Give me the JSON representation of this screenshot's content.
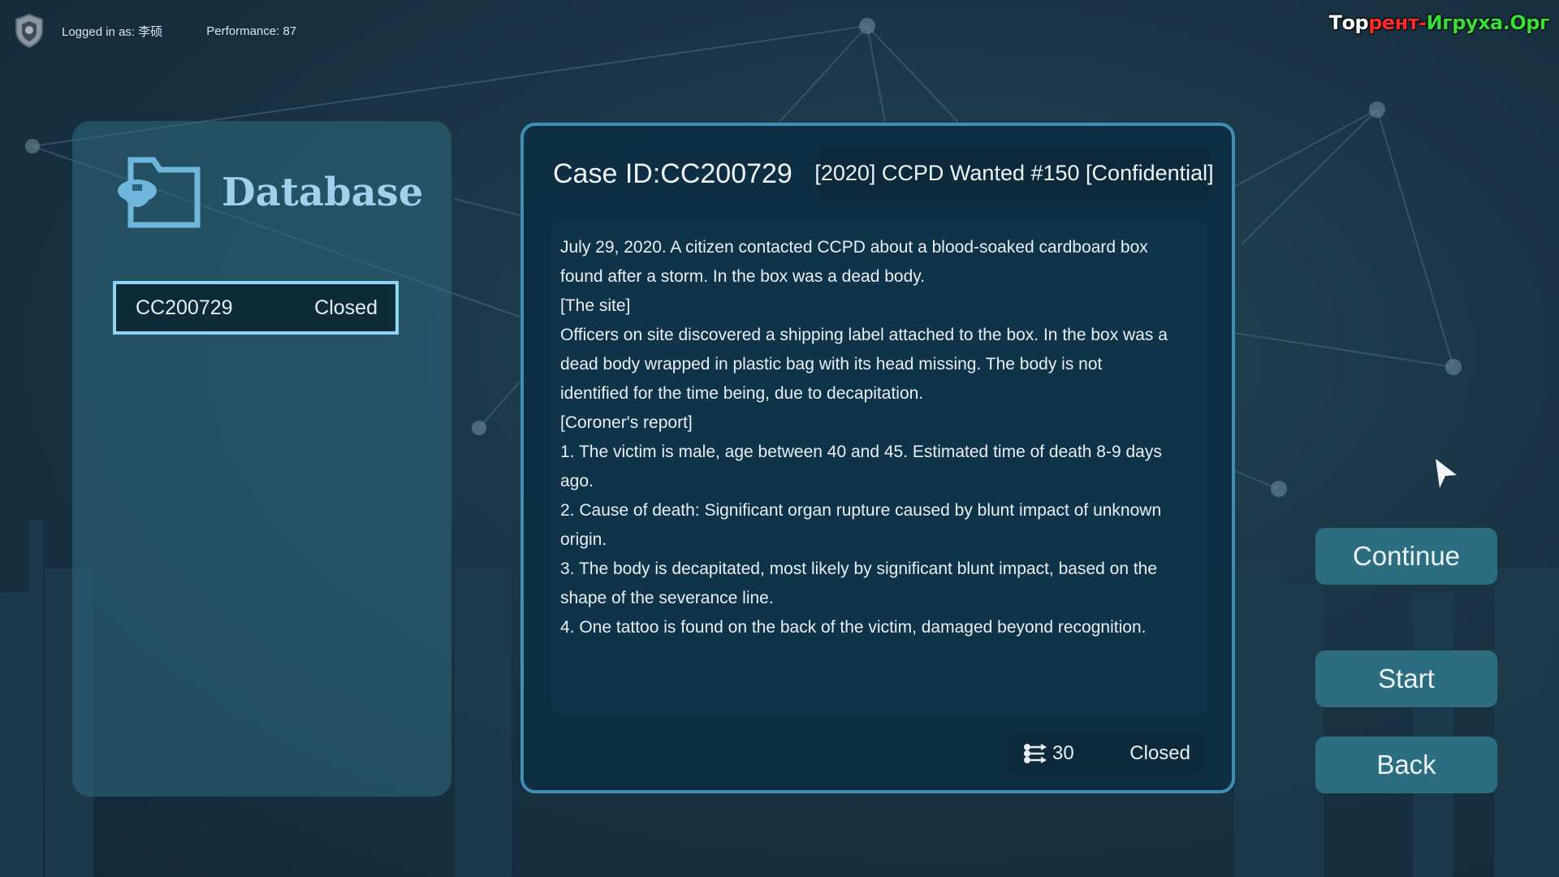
{
  "topbar": {
    "logged_in": "Logged in as: 李硕",
    "performance": "Performance: 87"
  },
  "watermark": {
    "part1": "Тор",
    "part2": "рент-",
    "part3": "Игруха",
    "part4": ".Орг"
  },
  "sidebar": {
    "title": "Database",
    "cases": [
      {
        "id": "CC200729",
        "status": "Closed"
      }
    ]
  },
  "case": {
    "id_label": "Case ID:CC200729",
    "title": "[2020] CCPD Wanted #150 [Confidential]",
    "report_lines": [
      "July 29, 2020. A citizen contacted CCPD about a blood-soaked cardboard box",
      "found after a storm. In the box was a dead body.",
      "[The site]",
      "Officers on site discovered a shipping label attached to the box. In the box was a",
      "dead body wrapped in plastic bag with its head missing. The body is not",
      "identified for the time being, due to decapitation.",
      "[Coroner's report]",
      "1. The victim is male, age between 40 and 45. Estimated time of death 8-9 days",
      "ago.",
      "2. Cause of death: Significant organ rupture caused by blunt impact of unknown",
      "origin.",
      "3. The body is decapitated, most likely by significant blunt impact, based on the",
      "shape of the severance line.",
      "4. One tattoo is found on the back of the victim, damaged beyond recognition."
    ],
    "footer_count": "30",
    "footer_status": "Closed"
  },
  "buttons": {
    "continue": "Continue",
    "start": "Start",
    "back": "Back"
  },
  "colors": {
    "accent": "#8fd3f5",
    "button_bg": "#2d6d80",
    "panel_border": "#3f8eb3"
  }
}
